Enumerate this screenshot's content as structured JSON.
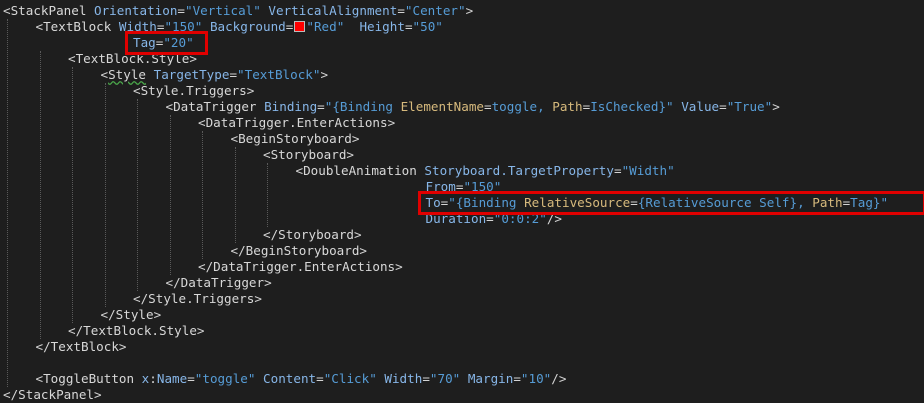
{
  "lines": [
    {
      "indent": 0,
      "tokens": [
        [
          "b",
          "<"
        ],
        [
          "t",
          "StackPanel "
        ],
        [
          "a",
          "Orientation"
        ],
        [
          "e",
          "="
        ],
        [
          "v",
          "\"Vertical\" "
        ],
        [
          "a",
          "VerticalAlignment"
        ],
        [
          "e",
          "="
        ],
        [
          "v",
          "\"Center\""
        ],
        [
          "b",
          ">"
        ]
      ]
    },
    {
      "indent": 1,
      "tokens": [
        [
          "b",
          "<"
        ],
        [
          "t",
          "TextBlock "
        ],
        [
          "a",
          "Width"
        ],
        [
          "e",
          "="
        ],
        [
          "v",
          "\"150\" "
        ],
        [
          "a",
          "Background"
        ],
        [
          "e",
          "="
        ],
        [
          "swatch",
          ""
        ],
        [
          "v",
          "\"Red\"  "
        ],
        [
          "a",
          "Height"
        ],
        [
          "e",
          "="
        ],
        [
          "v",
          "\"50\""
        ]
      ]
    },
    {
      "indent": 4,
      "tokens": [
        [
          "a",
          "Tag"
        ],
        [
          "e",
          "="
        ],
        [
          "v",
          "\"20\""
        ]
      ]
    },
    {
      "indent": 2,
      "tokens": [
        [
          "b",
          "<"
        ],
        [
          "t",
          "TextBlock.Style"
        ],
        [
          "b",
          ">"
        ]
      ]
    },
    {
      "indent": 3,
      "tokens": [
        [
          "b",
          "<"
        ],
        [
          "sq",
          "Style"
        ],
        [
          "t",
          " "
        ],
        [
          "a",
          "TargetType"
        ],
        [
          "e",
          "="
        ],
        [
          "v",
          "\"TextBlock\""
        ],
        [
          "b",
          ">"
        ]
      ]
    },
    {
      "indent": 4,
      "tokens": [
        [
          "b",
          "<"
        ],
        [
          "t",
          "Style.Triggers"
        ],
        [
          "b",
          ">"
        ]
      ]
    },
    {
      "indent": 5,
      "tokens": [
        [
          "b",
          "<"
        ],
        [
          "t",
          "DataTrigger "
        ],
        [
          "a",
          "Binding"
        ],
        [
          "e",
          "="
        ],
        [
          "v",
          "\"{Binding "
        ],
        [
          "k",
          "ElementName"
        ],
        [
          "e",
          "="
        ],
        [
          "v",
          "toggle, "
        ],
        [
          "k",
          "Path"
        ],
        [
          "e",
          "="
        ],
        [
          "v",
          "IsChecked}\" "
        ],
        [
          "a",
          "Value"
        ],
        [
          "e",
          "="
        ],
        [
          "v",
          "\"True\""
        ],
        [
          "b",
          ">"
        ]
      ]
    },
    {
      "indent": 6,
      "tokens": [
        [
          "b",
          "<"
        ],
        [
          "t",
          "DataTrigger.EnterActions"
        ],
        [
          "b",
          ">"
        ]
      ]
    },
    {
      "indent": 7,
      "tokens": [
        [
          "b",
          "<"
        ],
        [
          "t",
          "BeginStoryboard"
        ],
        [
          "b",
          ">"
        ]
      ]
    },
    {
      "indent": 8,
      "tokens": [
        [
          "b",
          "<"
        ],
        [
          "t",
          "Storyboard"
        ],
        [
          "b",
          ">"
        ]
      ]
    },
    {
      "indent": 9,
      "tokens": [
        [
          "b",
          "<"
        ],
        [
          "t",
          "DoubleAnimation "
        ],
        [
          "a",
          "Storyboard.TargetProperty"
        ],
        [
          "e",
          "="
        ],
        [
          "v",
          "\"Width\""
        ]
      ]
    },
    {
      "indent": 13,
      "tokens": [
        [
          "a",
          "From"
        ],
        [
          "e",
          "="
        ],
        [
          "v",
          "\"150\""
        ]
      ]
    },
    {
      "indent": 13,
      "tokens": [
        [
          "a",
          "To"
        ],
        [
          "e",
          "="
        ],
        [
          "v",
          "\"{Binding "
        ],
        [
          "k",
          "RelativeSource"
        ],
        [
          "e",
          "="
        ],
        [
          "v",
          "{RelativeSource Self}, "
        ],
        [
          "k",
          "Path"
        ],
        [
          "e",
          "="
        ],
        [
          "v",
          "Tag}\""
        ]
      ]
    },
    {
      "indent": 13,
      "tokens": [
        [
          "a",
          "Duration"
        ],
        [
          "e",
          "="
        ],
        [
          "v",
          "\"0:0:2\""
        ],
        [
          "b",
          "/>"
        ]
      ]
    },
    {
      "indent": 8,
      "tokens": [
        [
          "b",
          "</"
        ],
        [
          "t",
          "Storyboard"
        ],
        [
          "b",
          ">"
        ]
      ]
    },
    {
      "indent": 7,
      "tokens": [
        [
          "b",
          "</"
        ],
        [
          "t",
          "BeginStoryboard"
        ],
        [
          "b",
          ">"
        ]
      ]
    },
    {
      "indent": 6,
      "tokens": [
        [
          "b",
          "</"
        ],
        [
          "t",
          "DataTrigger.EnterActions"
        ],
        [
          "b",
          ">"
        ]
      ]
    },
    {
      "indent": 5,
      "tokens": [
        [
          "b",
          "</"
        ],
        [
          "t",
          "DataTrigger"
        ],
        [
          "b",
          ">"
        ]
      ]
    },
    {
      "indent": 4,
      "tokens": [
        [
          "b",
          "</"
        ],
        [
          "t",
          "Style.Triggers"
        ],
        [
          "b",
          ">"
        ]
      ]
    },
    {
      "indent": 3,
      "tokens": [
        [
          "b",
          "</"
        ],
        [
          "t",
          "Style"
        ],
        [
          "b",
          ">"
        ]
      ]
    },
    {
      "indent": 2,
      "tokens": [
        [
          "b",
          "</"
        ],
        [
          "t",
          "TextBlock.Style"
        ],
        [
          "b",
          ">"
        ]
      ]
    },
    {
      "indent": 1,
      "tokens": [
        [
          "b",
          "</"
        ],
        [
          "t",
          "TextBlock"
        ],
        [
          "b",
          ">"
        ]
      ]
    },
    {
      "indent": 0,
      "tokens": []
    },
    {
      "indent": 1,
      "tokens": [
        [
          "b",
          "<"
        ],
        [
          "t",
          "ToggleButton "
        ],
        [
          "a",
          "x"
        ],
        [
          "e",
          ":"
        ],
        [
          "a",
          "Name"
        ],
        [
          "e",
          "="
        ],
        [
          "v",
          "\"toggle\" "
        ],
        [
          "a",
          "Content"
        ],
        [
          "e",
          "="
        ],
        [
          "v",
          "\"Click\" "
        ],
        [
          "a",
          "Width"
        ],
        [
          "e",
          "="
        ],
        [
          "v",
          "\"70\" "
        ],
        [
          "a",
          "Margin"
        ],
        [
          "e",
          "="
        ],
        [
          "v",
          "\"10\""
        ],
        [
          "b",
          "/>"
        ]
      ]
    },
    {
      "indent": 0,
      "tokens": [
        [
          "b",
          "</"
        ],
        [
          "t",
          "StackPanel"
        ],
        [
          "b",
          ">"
        ]
      ]
    }
  ],
  "colors": {
    "background": "#1e1e1e",
    "highlight_box": "#e00000",
    "attribute": "#87b6e8",
    "value": "#569cd6",
    "binding_keyword": "#d7ba7d"
  }
}
